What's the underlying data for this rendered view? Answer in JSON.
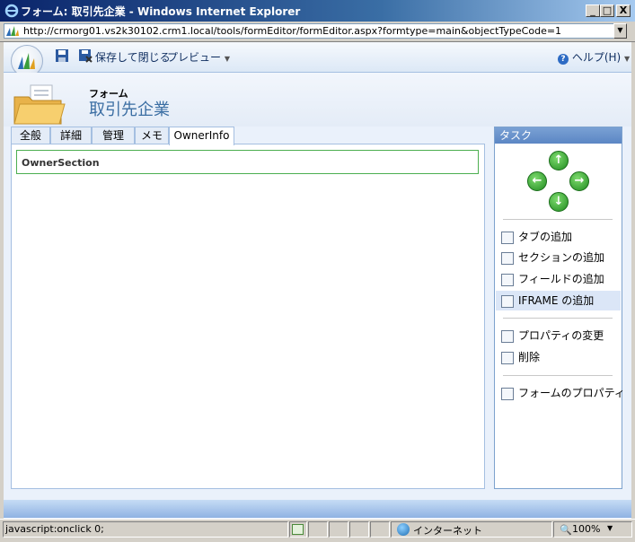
{
  "window": {
    "title": "フォーム: 取引先企業 - Windows Internet Explorer",
    "minimize": "_",
    "maximize": "□",
    "close": "X"
  },
  "address": {
    "url": "http://crmorg01.vs2k30102.crm1.local/tools/formEditor/formEditor.aspx?formtype=main&objectTypeCode=1"
  },
  "toolbar": {
    "save_close_label": "保存して閉じる",
    "preview_label": "プレビュー",
    "help_label": "ヘルプ(H)"
  },
  "header": {
    "form_label": "フォーム",
    "entity_title": "取引先企業"
  },
  "tabs": [
    {
      "label": "全般"
    },
    {
      "label": "詳細"
    },
    {
      "label": "管理"
    },
    {
      "label": "メモ"
    },
    {
      "label": "OwnerInfo",
      "active": true
    }
  ],
  "form": {
    "section_label": "OwnerSection"
  },
  "tasks": {
    "header": "タスク",
    "items": [
      {
        "label": "タブの追加",
        "icon": "add-tab-icon"
      },
      {
        "label": "セクションの追加",
        "icon": "add-section-icon"
      },
      {
        "label": "フィールドの追加",
        "icon": "add-field-icon"
      },
      {
        "label": "IFRAME の追加",
        "icon": "add-iframe-icon"
      },
      {
        "label": "プロパティの変更",
        "icon": "properties-icon"
      },
      {
        "label": "削除",
        "icon": "delete-icon"
      },
      {
        "label": "フォームのプロパティ",
        "icon": "form-properties-icon"
      }
    ]
  },
  "status": {
    "text": "javascript:onclick 0;",
    "zone": "インターネット",
    "zoom": "100%"
  },
  "colors": {
    "accent": "#3b6ea3",
    "section_border": "#4caf50",
    "arrow_green": "#1f8a1f"
  }
}
